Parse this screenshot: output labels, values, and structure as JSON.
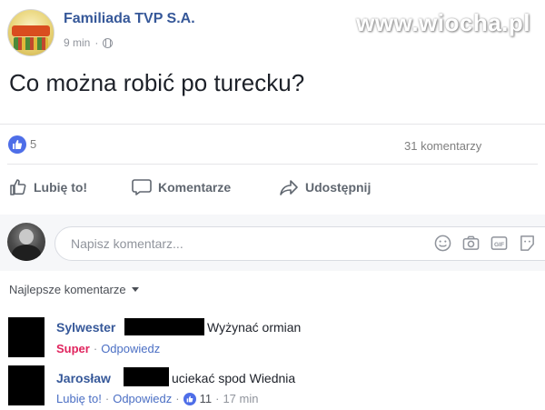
{
  "post": {
    "page_name": "Familiada TVP S.A.",
    "logo_text": "FAMILIADA",
    "time": "9 min",
    "meta_separator": "·",
    "text": "Co można robić po turecku?"
  },
  "watermark": "www.wiocha.pl",
  "stats": {
    "likes": "5",
    "comments": "31 komentarzy"
  },
  "actions": {
    "like": "Lubię to!",
    "comment": "Komentarze",
    "share": "Udostępnij"
  },
  "composer": {
    "placeholder": "Napisz komentarz..."
  },
  "sort": {
    "label": "Najlepsze komentarze"
  },
  "comments": [
    {
      "author": "Sylwester",
      "text": "Wyżynać ormian",
      "reaction": "Super",
      "reply": "Odpowiedz"
    },
    {
      "author": "Jarosław",
      "text": "uciekać spod Wiednia",
      "like": "Lubię to!",
      "reply": "Odpowiedz",
      "likes": "11",
      "time": "17 min"
    }
  ],
  "colors": {
    "name_blue": "#365899",
    "like_blue": "#4e6ee8",
    "super_red": "#e0245e",
    "muted_grey": "#90949c"
  },
  "icons": [
    "like-icon",
    "globe-icon",
    "thumbs-up-icon",
    "speech-bubble-icon",
    "share-arrow-icon",
    "emoji-icon",
    "camera-icon",
    "gif-icon",
    "sticker-icon",
    "chevron-down-icon"
  ]
}
